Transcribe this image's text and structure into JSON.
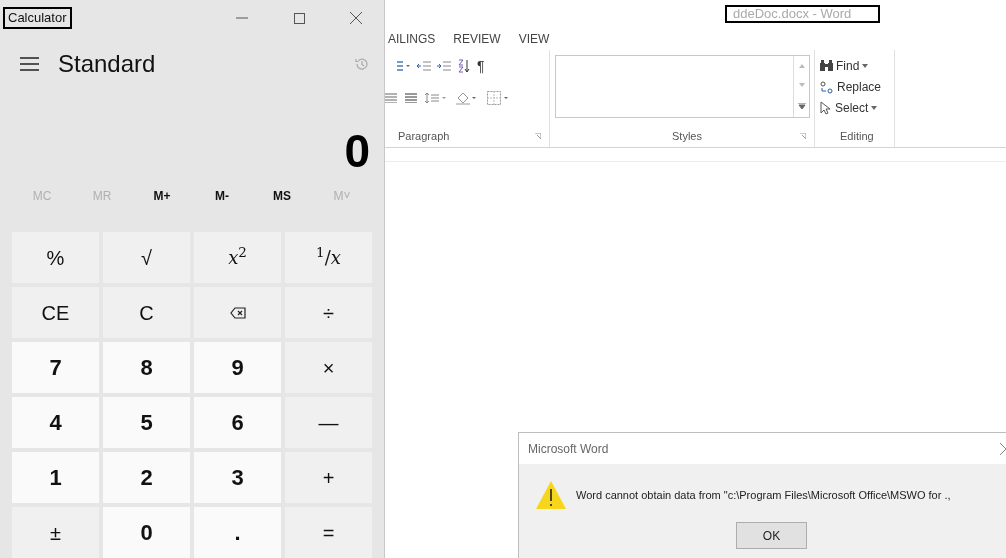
{
  "calculator": {
    "title": "Calculator",
    "mode": "Standard",
    "display": "0",
    "memory": [
      {
        "label": "MC",
        "disabled": true
      },
      {
        "label": "MR",
        "disabled": true
      },
      {
        "label": "M+",
        "disabled": false
      },
      {
        "label": "M-",
        "disabled": false
      },
      {
        "label": "MS",
        "disabled": false
      },
      {
        "label": "M˅",
        "disabled": true
      }
    ],
    "keys": [
      {
        "kind": "function",
        "label": "%"
      },
      {
        "kind": "function",
        "label": "√"
      },
      {
        "kind": "math",
        "label": "*x*$^{2}$"
      },
      {
        "kind": "math",
        "label": "$^{1}$/*x*"
      },
      {
        "kind": "function",
        "label": "CE"
      },
      {
        "kind": "function",
        "label": "C"
      },
      {
        "kind": "backspace"
      },
      {
        "kind": "function",
        "label": "÷"
      },
      {
        "kind": "digit",
        "label": "7"
      },
      {
        "kind": "digit",
        "label": "8"
      },
      {
        "kind": "digit",
        "label": "9"
      },
      {
        "kind": "function",
        "label": "×"
      },
      {
        "kind": "digit",
        "label": "4"
      },
      {
        "kind": "digit",
        "label": "5"
      },
      {
        "kind": "digit",
        "label": "6"
      },
      {
        "kind": "function",
        "label": "—"
      },
      {
        "kind": "digit",
        "label": "1"
      },
      {
        "kind": "digit",
        "label": "2"
      },
      {
        "kind": "digit",
        "label": "3"
      },
      {
        "kind": "function",
        "label": "+"
      },
      {
        "kind": "function",
        "label": "±"
      },
      {
        "kind": "digit",
        "label": "0"
      },
      {
        "kind": "digit",
        "label": "."
      },
      {
        "kind": "function",
        "label": "="
      }
    ]
  },
  "word": {
    "title": "ddeDoc.docx - Word",
    "tabs": [
      "AILINGS",
      "REVIEW",
      "VIEW"
    ],
    "paragraph": {
      "pilcrow": "¶",
      "label": "Paragraph"
    },
    "styles": {
      "label": "Styles"
    },
    "editing": {
      "label": "Editing",
      "commands": [
        {
          "kind": "find",
          "label": "Find",
          "dropdown": true
        },
        {
          "kind": "replace",
          "label": "Replace",
          "dropdown": false
        },
        {
          "kind": "select",
          "label": "Select",
          "dropdown": true
        }
      ]
    }
  },
  "dialog": {
    "title": "Microsoft Word",
    "message": "Word cannot obtain data from \"c:\\Program Files\\Microsoft Office\\MSWO for .,",
    "button": "OK"
  }
}
